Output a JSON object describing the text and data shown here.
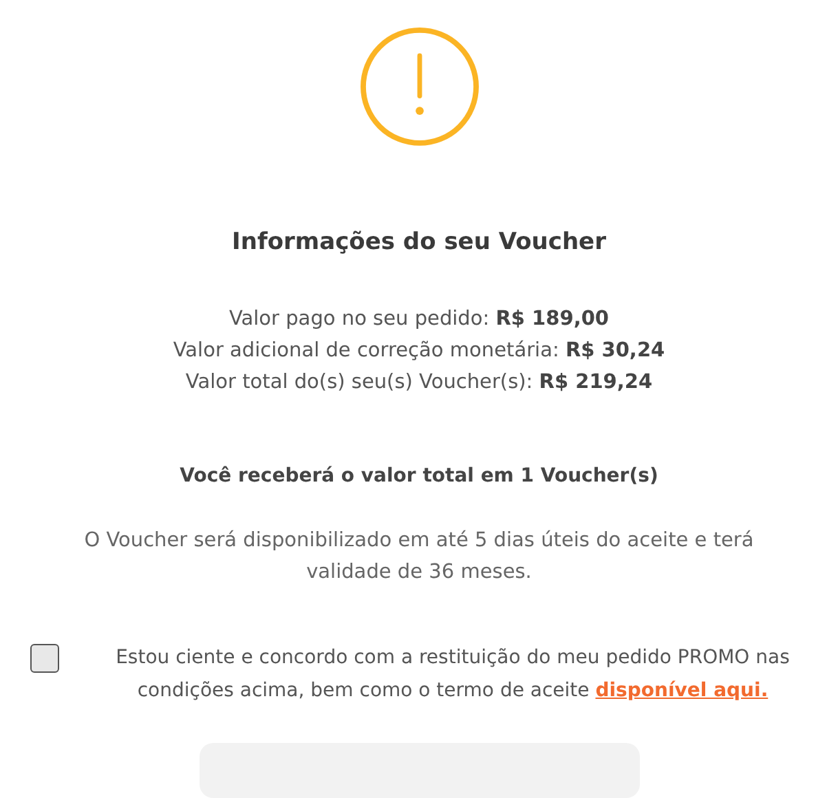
{
  "title": "Informações do seu Voucher",
  "values": [
    "Valor pago no seu pedido: **R$ 189,00**",
    "Valor adicional de correção monetária: **R$ 30,24**",
    "Valor total do(s) seu(s) Voucher(s): **R$ 219,24**"
  ],
  "summary": "Você receberá o valor total em 1 Voucher(s)",
  "notice": "O Voucher será disponibilizado em até 5 dias úteis do aceite e terá validade de 36 meses.",
  "agreement": {
    "checked": false,
    "text": "Estou ciente e concordo com a restituição do meu pedido PROMO nas condições acima, bem como o termo de aceite",
    "link": "disponível aqui."
  }
}
